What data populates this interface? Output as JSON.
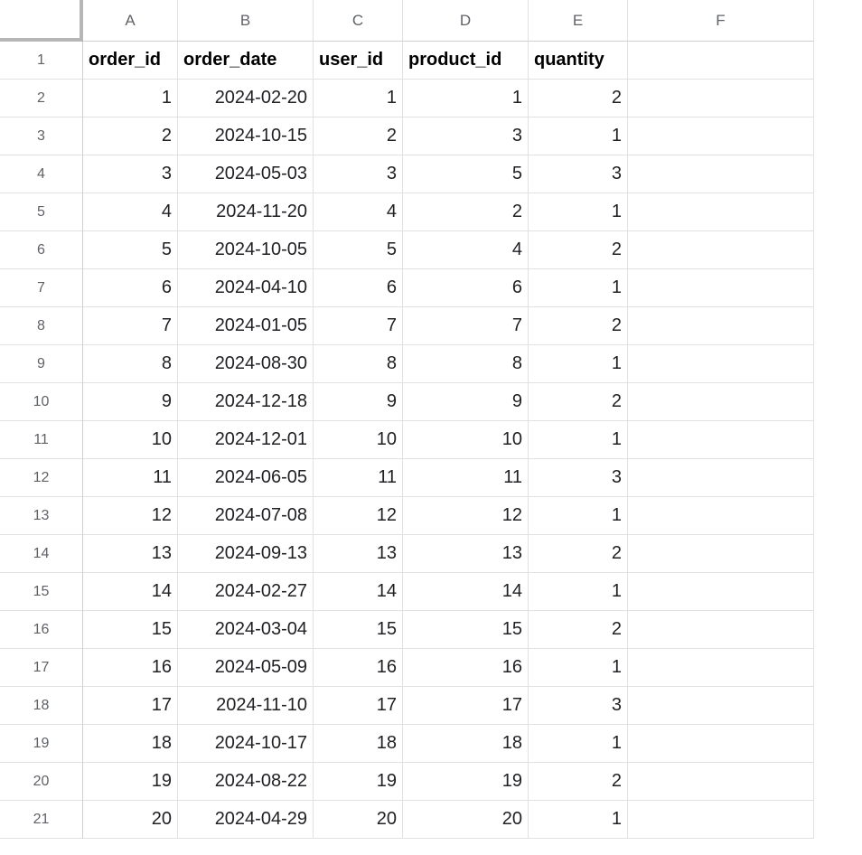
{
  "columns": [
    "A",
    "B",
    "C",
    "D",
    "E",
    "F"
  ],
  "row_numbers": [
    1,
    2,
    3,
    4,
    5,
    6,
    7,
    8,
    9,
    10,
    11,
    12,
    13,
    14,
    15,
    16,
    17,
    18,
    19,
    20,
    21
  ],
  "headers": [
    "order_id",
    "order_date",
    "user_id",
    "product_id",
    "quantity"
  ],
  "rows": [
    {
      "order_id": 1,
      "order_date": "2024-02-20",
      "user_id": 1,
      "product_id": 1,
      "quantity": 2
    },
    {
      "order_id": 2,
      "order_date": "2024-10-15",
      "user_id": 2,
      "product_id": 3,
      "quantity": 1
    },
    {
      "order_id": 3,
      "order_date": "2024-05-03",
      "user_id": 3,
      "product_id": 5,
      "quantity": 3
    },
    {
      "order_id": 4,
      "order_date": "2024-11-20",
      "user_id": 4,
      "product_id": 2,
      "quantity": 1
    },
    {
      "order_id": 5,
      "order_date": "2024-10-05",
      "user_id": 5,
      "product_id": 4,
      "quantity": 2
    },
    {
      "order_id": 6,
      "order_date": "2024-04-10",
      "user_id": 6,
      "product_id": 6,
      "quantity": 1
    },
    {
      "order_id": 7,
      "order_date": "2024-01-05",
      "user_id": 7,
      "product_id": 7,
      "quantity": 2
    },
    {
      "order_id": 8,
      "order_date": "2024-08-30",
      "user_id": 8,
      "product_id": 8,
      "quantity": 1
    },
    {
      "order_id": 9,
      "order_date": "2024-12-18",
      "user_id": 9,
      "product_id": 9,
      "quantity": 2
    },
    {
      "order_id": 10,
      "order_date": "2024-12-01",
      "user_id": 10,
      "product_id": 10,
      "quantity": 1
    },
    {
      "order_id": 11,
      "order_date": "2024-06-05",
      "user_id": 11,
      "product_id": 11,
      "quantity": 3
    },
    {
      "order_id": 12,
      "order_date": "2024-07-08",
      "user_id": 12,
      "product_id": 12,
      "quantity": 1
    },
    {
      "order_id": 13,
      "order_date": "2024-09-13",
      "user_id": 13,
      "product_id": 13,
      "quantity": 2
    },
    {
      "order_id": 14,
      "order_date": "2024-02-27",
      "user_id": 14,
      "product_id": 14,
      "quantity": 1
    },
    {
      "order_id": 15,
      "order_date": "2024-03-04",
      "user_id": 15,
      "product_id": 15,
      "quantity": 2
    },
    {
      "order_id": 16,
      "order_date": "2024-05-09",
      "user_id": 16,
      "product_id": 16,
      "quantity": 1
    },
    {
      "order_id": 17,
      "order_date": "2024-11-10",
      "user_id": 17,
      "product_id": 17,
      "quantity": 3
    },
    {
      "order_id": 18,
      "order_date": "2024-10-17",
      "user_id": 18,
      "product_id": 18,
      "quantity": 1
    },
    {
      "order_id": 19,
      "order_date": "2024-08-22",
      "user_id": 19,
      "product_id": 19,
      "quantity": 2
    },
    {
      "order_id": 20,
      "order_date": "2024-04-29",
      "user_id": 20,
      "product_id": 20,
      "quantity": 1
    }
  ]
}
